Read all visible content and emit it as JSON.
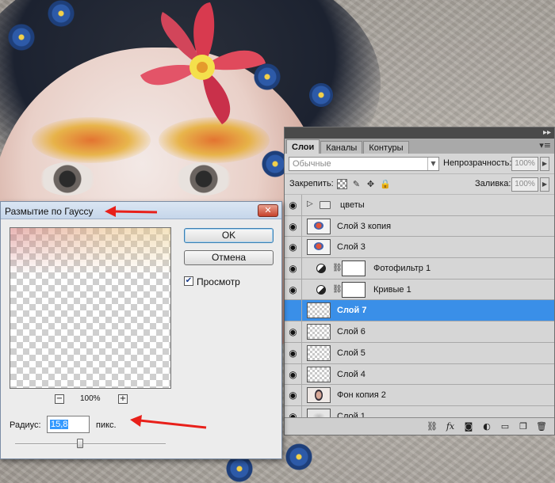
{
  "colors": {
    "selected_layer": "#3a8fe8",
    "annotation_arrow": "#e8201a",
    "dialog_title_bg": "#c6d6ea"
  },
  "layers_panel": {
    "tabs": [
      "Слои",
      "Каналы",
      "Контуры"
    ],
    "active_tab": "Слои",
    "menu_icon": "panel-menu-icon",
    "blend_mode": "Обычные",
    "opacity_label": "Непрозрачность:",
    "opacity_value": "100%",
    "lock_label": "Закрепить:",
    "fill_label": "Заливка:",
    "fill_value": "100%",
    "layers": [
      {
        "name": "цветы",
        "kind": "group",
        "visible": true,
        "selected": false
      },
      {
        "name": "Слой 3 копия",
        "kind": "pixel",
        "thumb": "art",
        "visible": true,
        "selected": false
      },
      {
        "name": "Слой 3",
        "kind": "pixel",
        "thumb": "art",
        "visible": true,
        "selected": false
      },
      {
        "name": "Фотофильтр 1",
        "kind": "adjustment",
        "visible": true,
        "selected": false
      },
      {
        "name": "Кривые 1",
        "kind": "adjustment",
        "visible": true,
        "selected": false
      },
      {
        "name": "Слой 7",
        "kind": "pixel",
        "thumb": "empty",
        "visible": false,
        "selected": true
      },
      {
        "name": "Слой 6",
        "kind": "pixel",
        "thumb": "empty",
        "visible": true,
        "selected": false
      },
      {
        "name": "Слой 5",
        "kind": "pixel",
        "thumb": "empty",
        "visible": true,
        "selected": false
      },
      {
        "name": "Слой 4",
        "kind": "pixel",
        "thumb": "empty",
        "visible": true,
        "selected": false
      },
      {
        "name": "Фон копия 2",
        "kind": "pixel",
        "thumb": "portrait",
        "visible": true,
        "selected": false
      },
      {
        "name": "Слой 1",
        "kind": "pixel",
        "thumb": "gray",
        "visible": true,
        "selected": false
      }
    ],
    "bottom_icons": [
      "link-layers-icon",
      "fx-icon",
      "add-mask-icon",
      "adjustment-layer-icon",
      "new-group-icon",
      "new-layer-icon",
      "trash-icon"
    ]
  },
  "dialog": {
    "title": "Размытие по Гауссу",
    "ok_label": "OK",
    "cancel_label": "Отмена",
    "preview_label": "Просмотр",
    "preview_checked": true,
    "zoom_value": "100%",
    "zoom_out": "−",
    "zoom_in": "+",
    "radius_label": "Радиус:",
    "radius_value": "15,8",
    "radius_unit": "пикс.",
    "slider_fraction": 0.43
  }
}
